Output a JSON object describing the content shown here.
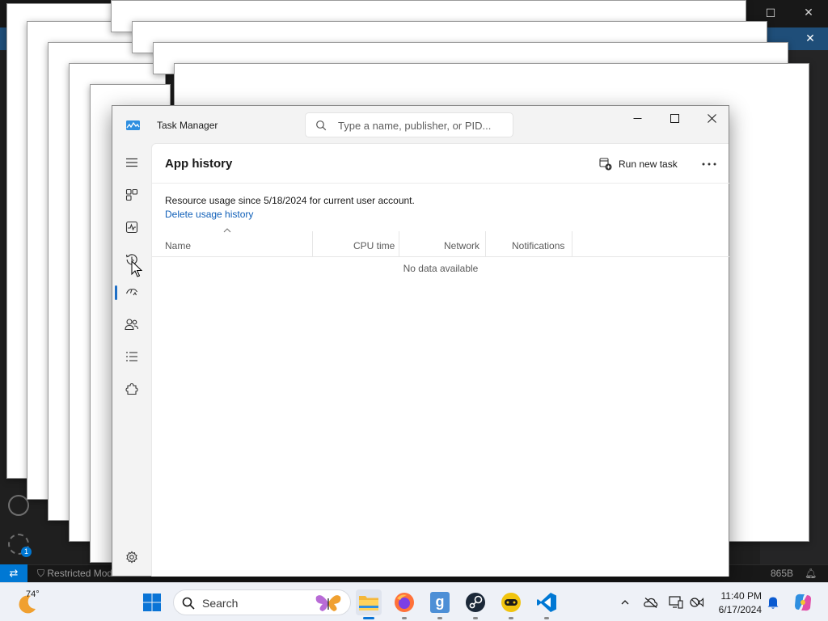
{
  "taskmanager": {
    "title": "Task Manager",
    "search_placeholder": "Type a name, publisher, or PID...",
    "page_title": "App history",
    "run_new_task_label": "Run new task",
    "info_text": "Resource usage since 5/18/2024 for current user account.",
    "delete_history_label": "Delete usage history",
    "columns": [
      "Name",
      "CPU time",
      "Network",
      "Notifications"
    ],
    "empty_message": "No data available",
    "nav_items": [
      "menu",
      "processes",
      "performance",
      "app-history",
      "startup-apps",
      "users",
      "details",
      "services"
    ],
    "active_nav": "app-history"
  },
  "background_app": {
    "status_restricted": "Restricted Mode",
    "status_size": "865B",
    "accounts_badge": "1"
  },
  "taskbar": {
    "weather_temp": "74°",
    "search_label": "Search",
    "clock_time": "11:40 PM",
    "clock_date": "6/17/2024",
    "pinned_apps": [
      "file-explorer",
      "firefox",
      "gog-galaxy",
      "steam",
      "gamepad-app",
      "visual-studio-code"
    ]
  },
  "colors": {
    "accent": "#1f6fc5",
    "link": "#0f5fb8",
    "vscode_blue": "#0078d4"
  }
}
